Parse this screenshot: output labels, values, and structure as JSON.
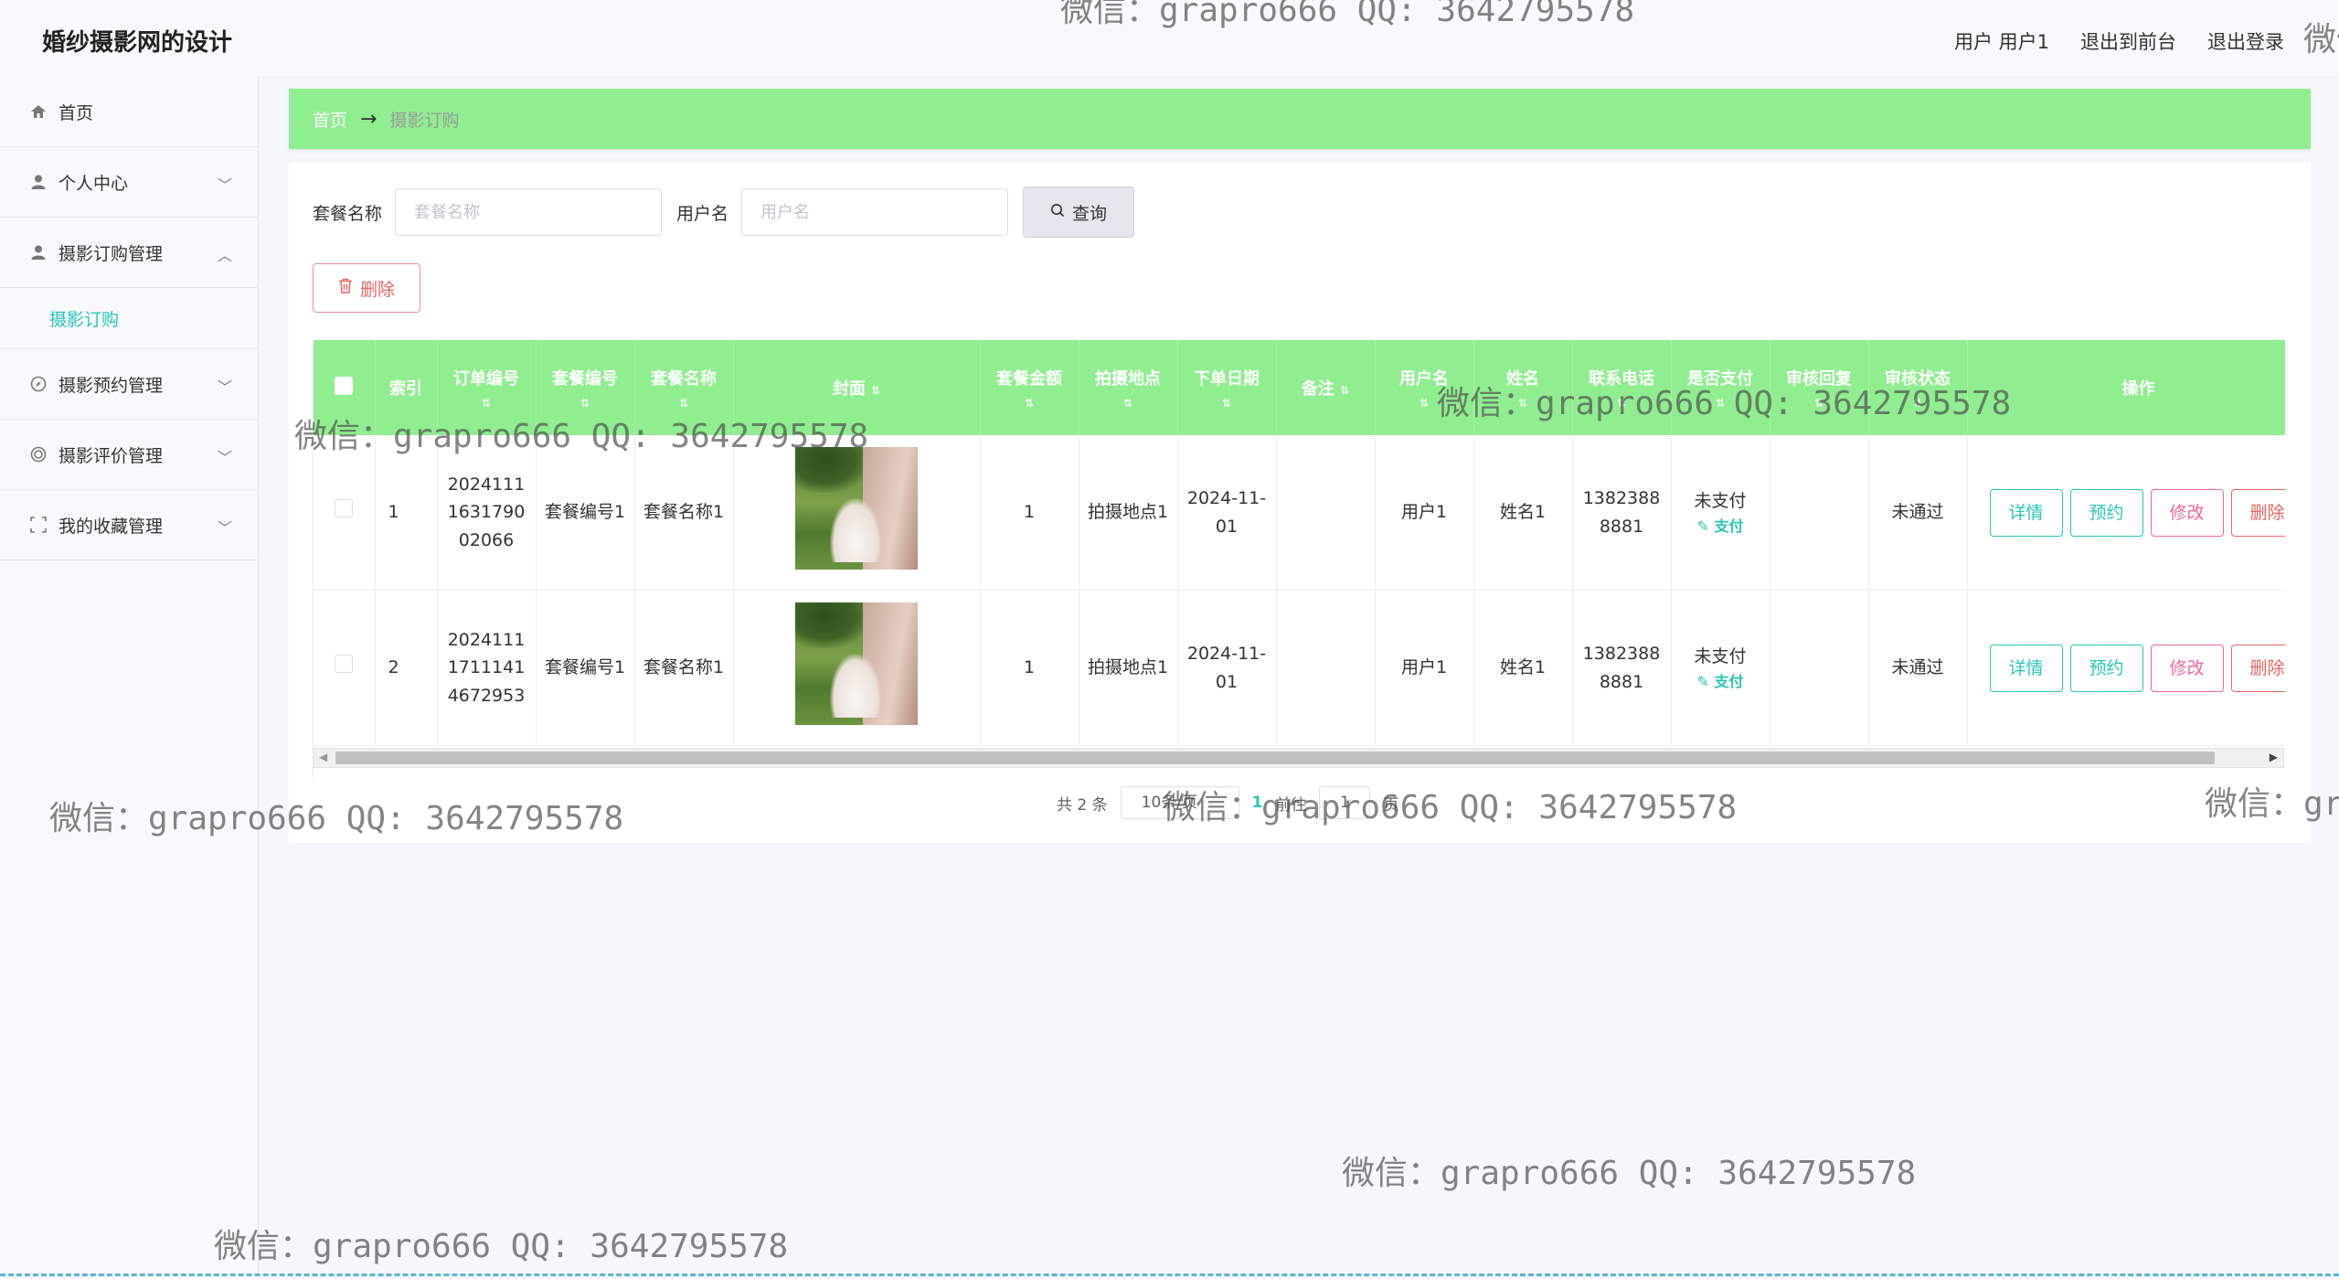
{
  "app": {
    "title": "婚纱摄影网的设计"
  },
  "top_links": {
    "user": "用户 用户1",
    "to_front": "退出到前台",
    "logout": "退出登录"
  },
  "sidebar": {
    "items": [
      {
        "label": "首页",
        "icon": "home-icon"
      },
      {
        "label": "个人中心",
        "icon": "user-icon"
      },
      {
        "label": "摄影订购管理",
        "icon": "user-admin-icon"
      },
      {
        "label": "摄影订购",
        "sub": true
      },
      {
        "label": "摄影预约管理",
        "icon": "compass-icon"
      },
      {
        "label": "摄影评价管理",
        "icon": "target-icon"
      },
      {
        "label": "我的收藏管理",
        "icon": "frame-icon"
      }
    ]
  },
  "breadcrumb": {
    "home": "首页",
    "arrow": "→",
    "current": "摄影订购"
  },
  "search": {
    "package_label": "套餐名称",
    "package_placeholder": "套餐名称",
    "user_label": "用户名",
    "user_placeholder": "用户名",
    "query_label": "查询"
  },
  "toolbar": {
    "delete_label": "删除"
  },
  "table": {
    "columns": [
      "索引",
      "订单编号",
      "套餐编号",
      "套餐名称",
      "封面",
      "套餐金额",
      "拍摄地点",
      "下单日期",
      "备注",
      "用户名",
      "姓名",
      "联系电话",
      "是否支付",
      "审核回复",
      "审核状态",
      "操作"
    ],
    "rows": [
      {
        "index": "1",
        "order_no": "20241111631790 02066",
        "package_no": "套餐编号1",
        "package_name": "套餐名称1",
        "amount": "1",
        "location": "拍摄地点1",
        "date": "2024-11-01",
        "remark": "",
        "username": "用户1",
        "name": "姓名1",
        "phone": "13823888881",
        "paid": "未支付",
        "pay_link": "支付",
        "reply": "",
        "status": "未通过"
      },
      {
        "index": "2",
        "order_no": "20241111711141 4672953",
        "package_no": "套餐编号1",
        "package_name": "套餐名称1",
        "amount": "1",
        "location": "拍摄地点1",
        "date": "2024-11-01",
        "remark": "",
        "username": "用户1",
        "name": "姓名1",
        "phone": "13823888881",
        "paid": "未支付",
        "pay_link": "支付",
        "reply": "",
        "status": "未通过"
      }
    ],
    "actions": {
      "detail": "详情",
      "book": "预约",
      "edit": "修改",
      "delete": "删除"
    }
  },
  "pager": {
    "total": "共 2 条",
    "size": "10条/页",
    "page": "1",
    "goto": "前往",
    "jump_value": "1",
    "page_suffix": "页"
  },
  "watermark": "微信：grapro666 QQ: 3642795578"
}
